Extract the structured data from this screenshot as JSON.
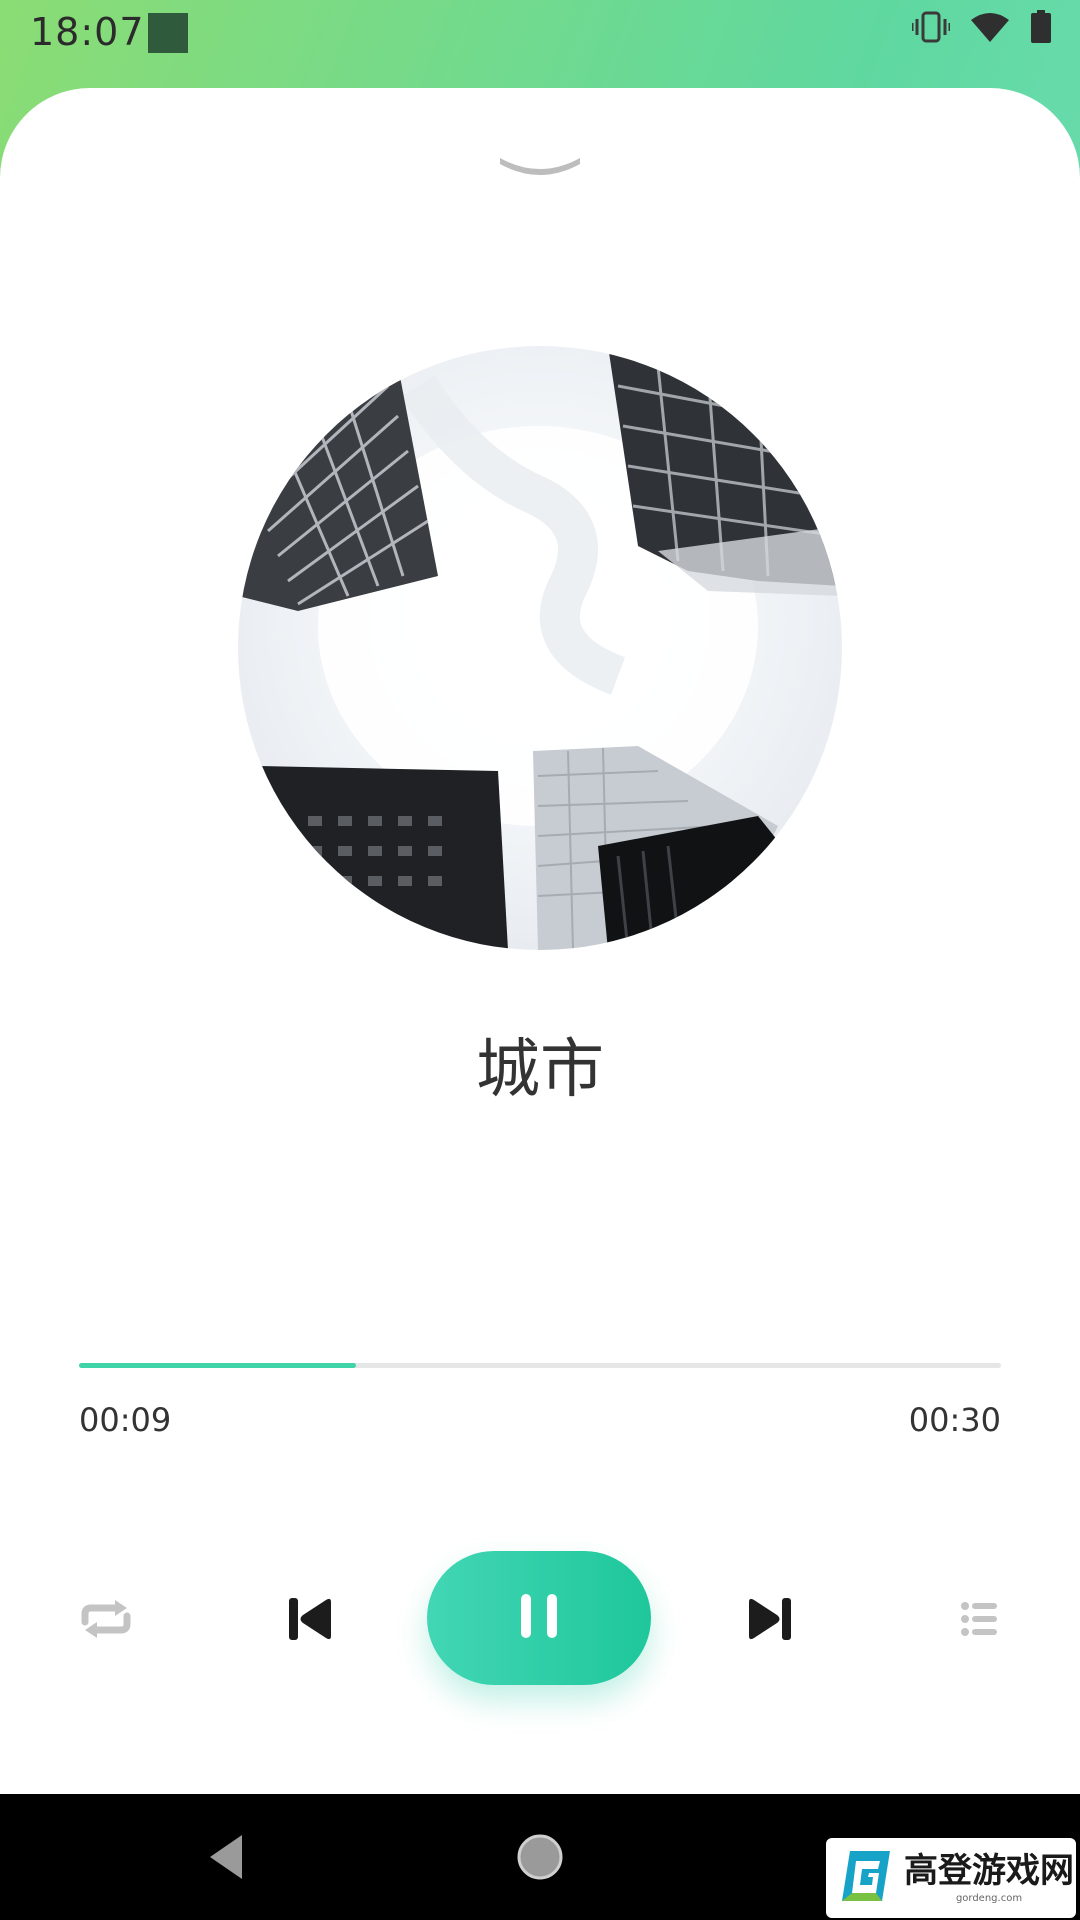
{
  "status_bar": {
    "time": "18:07",
    "icons": [
      "vibrate-icon",
      "wifi-icon",
      "battery-icon"
    ]
  },
  "player": {
    "song_title": "城市",
    "progress_fraction": 0.3,
    "current_time": "00:09",
    "total_time": "00:30",
    "accent_color": "#3fd3a8",
    "controls": [
      "repeat-icon",
      "previous-icon",
      "pause-icon",
      "next-icon",
      "playlist-icon"
    ]
  },
  "watermark": {
    "title": "高登游戏网",
    "url": "gordeng.com"
  }
}
